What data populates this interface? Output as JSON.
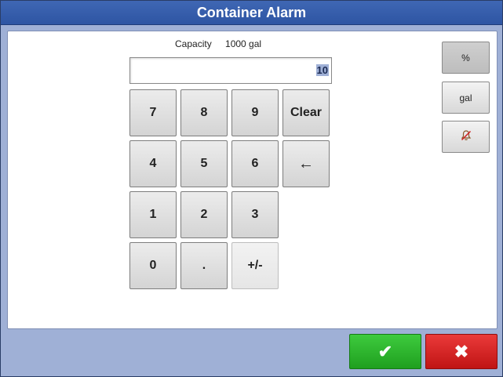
{
  "window": {
    "title": "Container Alarm"
  },
  "capacity": {
    "label": "Capacity",
    "value": "1000 gal"
  },
  "entry": {
    "value": "10"
  },
  "keypad": {
    "k7": "7",
    "k8": "8",
    "k9": "9",
    "clear": "Clear",
    "k4": "4",
    "k5": "5",
    "k6": "6",
    "backspace": "←",
    "k1": "1",
    "k2": "2",
    "k3": "3",
    "k0": "0",
    "dot": ".",
    "plus_minus": "+/-"
  },
  "units": {
    "percent": "%",
    "gal": "gal",
    "alarm_off_icon": "bell-off-icon"
  },
  "actions": {
    "ok": "✔",
    "cancel": "✖"
  },
  "colors": {
    "accent": "#2e55a3",
    "ok": "#22a822",
    "cancel": "#d01e1e"
  }
}
